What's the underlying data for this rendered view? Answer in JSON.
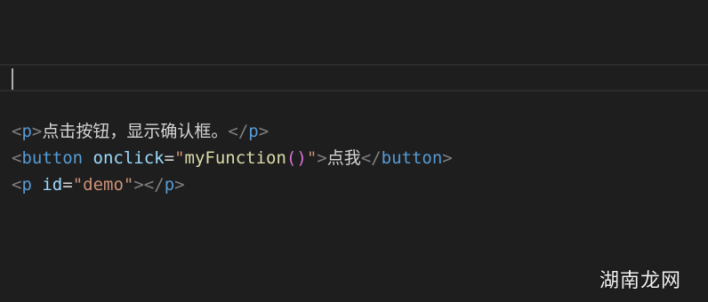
{
  "colors": {
    "background": "#1e1e1e",
    "current_line_border": "#2c2c2c",
    "tag_name": "#569cd6",
    "bracket": "#808080",
    "attribute": "#9cdcfe",
    "string": "#ce9178",
    "function": "#dcdcaa",
    "text": "#d4d4d4"
  },
  "code": {
    "line1": {
      "open_bracket": "<",
      "tag_open": "p",
      "open_close": ">",
      "content": "点击按钮，显示确认框。",
      "close_bracket": "</",
      "tag_close": "p",
      "close_end": ">"
    },
    "line2": {
      "open_bracket": "<",
      "tag_open": "button",
      "space": " ",
      "attr_name": "onclick",
      "equals": "=",
      "quote_open": "\"",
      "fn_name": "myFunction",
      "parens": "()",
      "quote_close": "\"",
      "open_close": ">",
      "content": "点我",
      "close_bracket": "</",
      "tag_close": "button",
      "close_end": ">"
    },
    "line3": {
      "open_bracket": "<",
      "tag_open": "p",
      "space": " ",
      "attr_name": "id",
      "equals": "=",
      "attr_value": "\"demo\"",
      "open_close": ">",
      "close_bracket": "</",
      "tag_close": "p",
      "close_end": ">"
    }
  },
  "watermark": {
    "text": "湖南龙网"
  }
}
